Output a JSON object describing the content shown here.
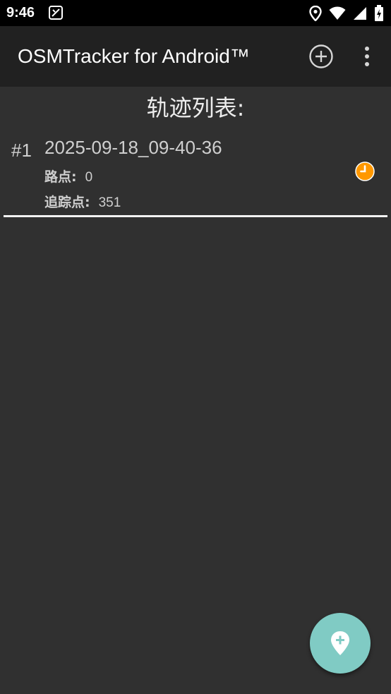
{
  "status_bar": {
    "time": "9:46",
    "icons": [
      "notification-icon",
      "location-icon",
      "wifi-icon",
      "signal-icon",
      "battery-icon"
    ]
  },
  "app_bar": {
    "title": "OSMTracker for Android™",
    "actions": [
      "add-circle-icon",
      "more-vert-icon"
    ]
  },
  "main": {
    "heading": "轨迹列表:",
    "tracks": [
      {
        "number": "#1",
        "name": "2025-09-18_09-40-36",
        "waypoints_label": "路点:",
        "waypoints_value": "0",
        "trackpoints_label": "追踪点:",
        "trackpoints_value": "351",
        "status_icon": "clock-icon"
      }
    ]
  },
  "fab": {
    "icon": "add-location-icon"
  },
  "colors": {
    "background": "#303030",
    "app_bar": "#212121",
    "status_bar": "#000000",
    "accent_fab": "#80cbc4",
    "status_orange": "#ff9800"
  }
}
